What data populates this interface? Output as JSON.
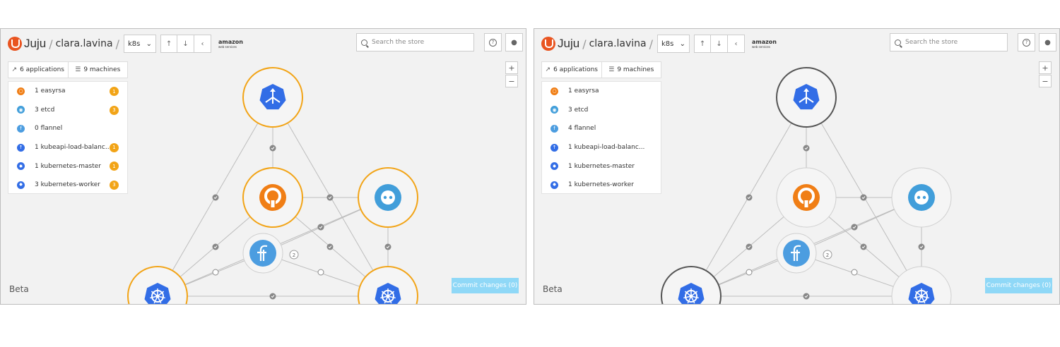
{
  "brand": "Juju",
  "user": "clara.lavina",
  "model": "k8s",
  "cloud": {
    "top": "amazon",
    "bottom": "web services"
  },
  "search_placeholder": "Search the store",
  "tabs": {
    "applications": "6 applications",
    "machines": "9 machines"
  },
  "beta": "Beta",
  "commit_label": "Commit changes (0)",
  "zoom": {
    "in": "+",
    "out": "−"
  },
  "colors": {
    "orange_ring": "#f2a417",
    "grey_ring": "#555555",
    "blue": "#326de6",
    "easyrsa": "#f07e15",
    "etcd": "#419eda",
    "flannel": "#4c9de0"
  },
  "panels": [
    {
      "apps": [
        {
          "label": "1 easyrsa",
          "icon": "easyrsa-icon",
          "badge": "1"
        },
        {
          "label": "3 etcd",
          "icon": "etcd-icon",
          "badge": "3"
        },
        {
          "label": "0 flannel",
          "icon": "flannel-icon",
          "badge": ""
        },
        {
          "label": "1 kubeapi-load-balanc...",
          "icon": "kubeapi-icon",
          "badge": "1"
        },
        {
          "label": "1 kubernetes-master",
          "icon": "kubernetes-icon",
          "badge": "1"
        },
        {
          "label": "3 kubernetes-worker",
          "icon": "kubernetes-icon",
          "badge": "3"
        }
      ],
      "ring": "#f2a417",
      "relation_count": "2"
    },
    {
      "apps": [
        {
          "label": "1 easyrsa",
          "icon": "easyrsa-icon",
          "badge": ""
        },
        {
          "label": "3 etcd",
          "icon": "etcd-icon",
          "badge": ""
        },
        {
          "label": "4 flannel",
          "icon": "flannel-icon",
          "badge": ""
        },
        {
          "label": "1 kubeapi-load-balanc...",
          "icon": "kubeapi-icon",
          "badge": ""
        },
        {
          "label": "1 kubernetes-master",
          "icon": "kubernetes-icon",
          "badge": ""
        },
        {
          "label": "1 kubernetes-worker",
          "icon": "kubernetes-icon",
          "badge": ""
        }
      ],
      "ring": "#bbbbbb",
      "relation_count": "2"
    }
  ]
}
